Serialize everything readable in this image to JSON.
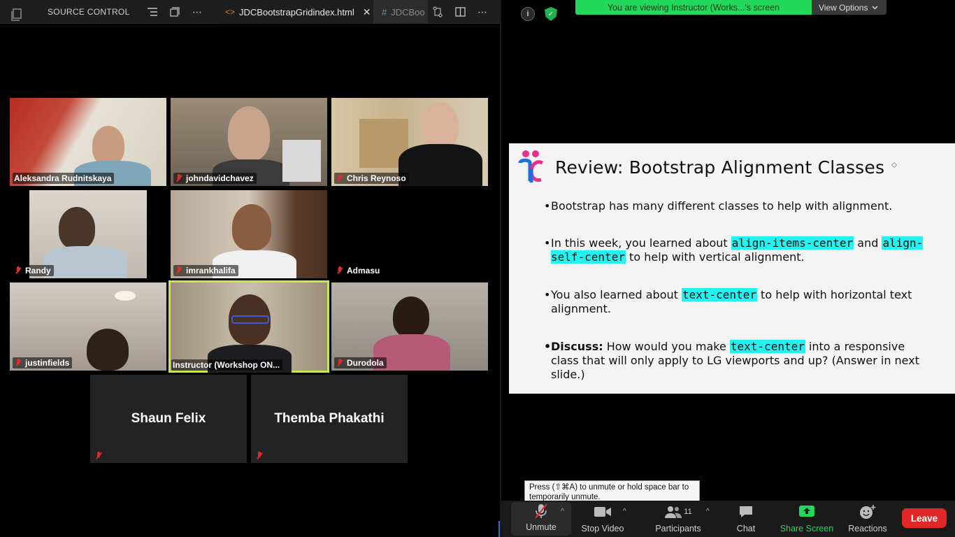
{
  "editor": {
    "panel_title": "SOURCE CONTROL",
    "active_tab": "JDCBootstrapGridindex.html",
    "active_tab_lang_icon": "<>",
    "second_tab": "JDCBoo",
    "second_tab_lang_icon": "#",
    "close_glyph": "✕"
  },
  "gallery": {
    "participants": [
      {
        "name": "Aleksandra Rudnitskaya",
        "muted": false
      },
      {
        "name": "johndavidchavez",
        "muted": true
      },
      {
        "name": "Chris Reynoso",
        "muted": true
      },
      {
        "name": "Randy",
        "muted": true
      },
      {
        "name": "imrankhalifa",
        "muted": true
      },
      {
        "name": "Admasu",
        "muted": true
      },
      {
        "name": "justinfields",
        "muted": true
      },
      {
        "name": "Instructor (Workshop ON...",
        "muted": false,
        "active": true
      },
      {
        "name": "Durodola",
        "muted": true
      },
      {
        "name": "Shaun Felix",
        "muted": true,
        "video": false
      },
      {
        "name": "Themba Phakathi",
        "muted": true,
        "video": false
      }
    ]
  },
  "zoom": {
    "info_glyph": "i",
    "viewing_banner": "You are viewing Instructor (Works...'s screen",
    "view_options": "View Options",
    "tooltip": "Press  (⇧⌘A) to unmute or hold space bar to temporarily unmute.",
    "toolbar": {
      "unmute": "Unmute",
      "stop_video": "Stop Video",
      "participants": "Participants",
      "participants_count": "11",
      "chat": "Chat",
      "share_screen": "Share Screen",
      "reactions": "Reactions",
      "leave": "Leave"
    },
    "colors": {
      "banner_green": "#23d95c",
      "active_speaker": "#c8e650",
      "leave_red": "#e02828",
      "code_highlight": "#21f3f0"
    }
  },
  "slide": {
    "title": "Review: Bootstrap Alignment Classes",
    "b1": "Bootstrap has many different classes to help with alignment.",
    "b2_pre": "In this week, you learned about ",
    "b2_code1": "align-items-center",
    "b2_mid": " and ",
    "b2_code2": "align-self-center",
    "b2_post": " to help with vertical alignment.",
    "b3_pre": "You also learned about ",
    "b3_code": "text-center",
    "b3_post": " to help with horizontal text alignment.",
    "b4_bold": "Discuss:",
    "b4_pre": " How would you make ",
    "b4_code": "text-center",
    "b4_post": " into a responsive class that will only apply to LG viewports and up? (Answer in next slide.)"
  }
}
